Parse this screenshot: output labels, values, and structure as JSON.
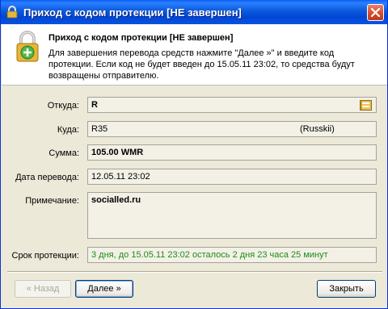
{
  "window": {
    "title": "Приход с кодом протекции [НЕ завершен]"
  },
  "header": {
    "title": "Приход с кодом протекции [НЕ завершен]",
    "description": "Для завершения перевода средств нажмите \"Далее »\" и введите код протекции. Если код не будет введен до 15.05.11 23:02, то средства будут возвращены отправителю."
  },
  "form": {
    "from_label": "Откуда:",
    "from_value": "R",
    "to_label": "Куда:",
    "to_value": "R35",
    "to_name": "(Russkii)",
    "amount_label": "Сумма:",
    "amount_value": "105.00 WMR",
    "date_label": "Дата перевода:",
    "date_value": "12.05.11 23:02",
    "note_label": "Примечание:",
    "note_value": "socialled.ru",
    "protection_label": "Срок протекции:",
    "protection_value": "3 дня, до 15.05.11 23:02 осталось 2 дня 23 часа 25 минут"
  },
  "buttons": {
    "back": "« Назад",
    "next": "Далее »",
    "close": "Закрыть"
  },
  "colors": {
    "protection_text": "#1E8A1E",
    "titlebar": "#0A5FF4"
  }
}
